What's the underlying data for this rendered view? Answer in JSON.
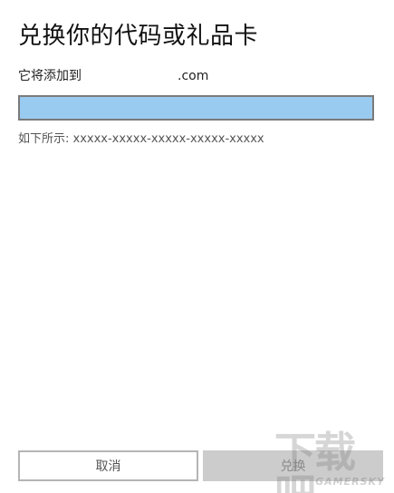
{
  "dialog": {
    "title": "兑换你的代码或礼品卡",
    "account_prefix": "它将添加到",
    "account_suffix": ".com",
    "code_input_value": "",
    "hint": "如下所示: xxxxx-xxxxx-xxxxx-xxxxx-xxxxx",
    "cancel_label": "取消",
    "redeem_label": "兑换"
  },
  "colors": {
    "input_background": "#99caf0",
    "redeem_disabled_background": "#cccccc"
  },
  "watermark": {
    "logo": "下载吧",
    "text": "GAMERSKY"
  }
}
